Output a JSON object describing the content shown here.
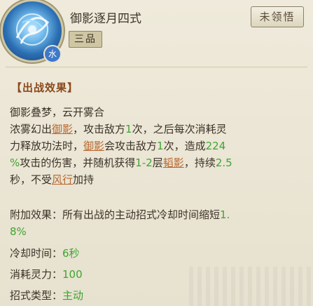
{
  "skill": {
    "name": "御影逐月四式",
    "grade": "三品",
    "element_badge": "水",
    "status": "未领悟",
    "icon": "swirling-moon-skill-icon"
  },
  "effect": {
    "section_title": "【出战效果】",
    "lines": [
      [
        {
          "t": "御影叠梦，云开雾合",
          "s": "n"
        }
      ],
      [
        {
          "t": "浓雾幻出",
          "s": "n"
        },
        {
          "t": "御影",
          "s": "k"
        },
        {
          "t": "，攻击敌方",
          "s": "n"
        },
        {
          "t": "1",
          "s": "g"
        },
        {
          "t": "次，之后每次消耗灵",
          "s": "n"
        }
      ],
      [
        {
          "t": "力释放功法时，",
          "s": "n"
        },
        {
          "t": "御影",
          "s": "k"
        },
        {
          "t": "会攻击敌方",
          "s": "n"
        },
        {
          "t": "1",
          "s": "g"
        },
        {
          "t": "次，造成",
          "s": "n"
        },
        {
          "t": "224",
          "s": "g"
        }
      ],
      [
        {
          "t": "%",
          "s": "g"
        },
        {
          "t": "攻击的伤害，并随机获得",
          "s": "n"
        },
        {
          "t": "1-2",
          "s": "g"
        },
        {
          "t": "层",
          "s": "n"
        },
        {
          "t": "韬影",
          "s": "k"
        },
        {
          "t": "，持续",
          "s": "n"
        },
        {
          "t": "2.5",
          "s": "g"
        }
      ],
      [
        {
          "t": "秒，不受",
          "s": "n"
        },
        {
          "t": "风行",
          "s": "k"
        },
        {
          "t": "加持",
          "s": "n"
        }
      ]
    ]
  },
  "extra": {
    "lines": [
      [
        {
          "t": "附加效果：所有出战的主动招式冷却时间缩短",
          "s": "n"
        },
        {
          "t": "1.",
          "s": "g"
        }
      ],
      [
        {
          "t": "8%",
          "s": "g"
        }
      ]
    ]
  },
  "stats": {
    "cooldown": {
      "label": "冷却时间：",
      "value": "6秒"
    },
    "spirit_cost": {
      "label": "消耗灵力：",
      "value": "100"
    },
    "move_type": {
      "label": "招式类型：",
      "value": "主动"
    }
  },
  "colors": {
    "highlight_number": "#3ea531",
    "keyword": "#b8672e",
    "section_title": "#8a4a1c",
    "background": "#e9e4d3"
  }
}
